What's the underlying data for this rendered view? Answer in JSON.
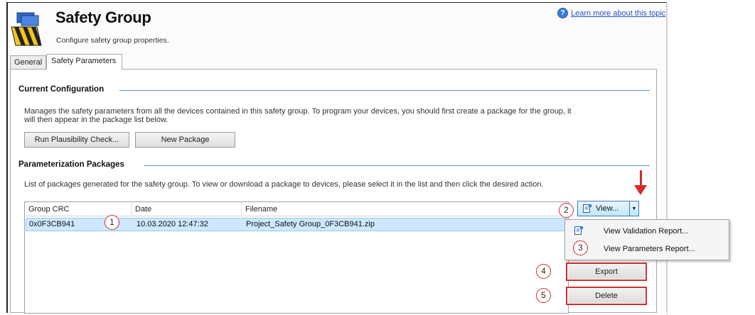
{
  "header": {
    "title": "Safety Group",
    "subtitle": "Configure safety group properties.",
    "help_link": "Learn more about this topic",
    "help_icon": "help-icon"
  },
  "tabs": [
    {
      "label": "General",
      "active": false
    },
    {
      "label": "Safety Parameters",
      "active": true
    }
  ],
  "current_configuration": {
    "title": "Current Configuration",
    "description_line1": "Manages the safety parameters from all the devices contained in this safety group.  To program your devices, you should first create a package for the group, it",
    "description_line2": "will then appear in the package list below.",
    "buttons": {
      "plausibility": "Run Plausibility Check...",
      "new_package": "New Package"
    }
  },
  "packages": {
    "title": "Parameterization Packages",
    "description": "List of packages generated for the safety group.  To view or download a package to devices, please select it in the list and then click the desired action.",
    "columns": [
      "Group CRC",
      "Date",
      "Filename"
    ],
    "rows": [
      {
        "crc": "0x0F3CB941",
        "date": "10.03.2020 12:47:32",
        "filename": "Project_Safety Group_0F3CB941.zip",
        "selected": true
      }
    ]
  },
  "view_button": {
    "label": "View...",
    "icon": "document-report-icon",
    "dropdown_icon": "dropdown-arrow-icon"
  },
  "view_menu": {
    "items": [
      {
        "label": "View Validation Report...",
        "icon": "document-report-icon"
      },
      {
        "label": "View Parameters Report...",
        "icon": ""
      }
    ]
  },
  "actions": {
    "export": "Export",
    "delete": "Delete"
  },
  "annotations": {
    "markers": [
      "1",
      "2",
      "3",
      "4",
      "5"
    ],
    "highlight_color": "#d22d2d",
    "pointer": "down-arrow-indicator"
  },
  "colors": {
    "selection": "#cde8ff",
    "section_line": "#5b8fc9",
    "link": "#2255cc"
  }
}
